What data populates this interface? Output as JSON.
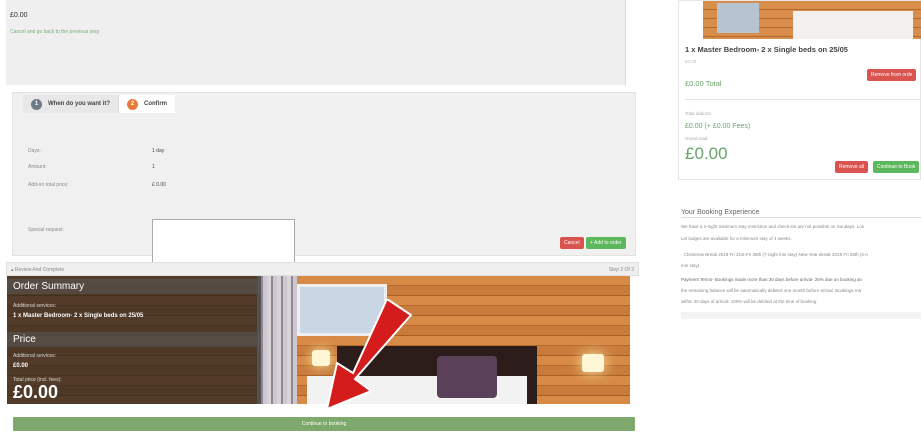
{
  "top": {
    "amount": "£0.00",
    "cancel_link": "Cancel and go back to the previous step"
  },
  "addon": {
    "tabs": [
      {
        "num": "1",
        "label": "When do you want it?"
      },
      {
        "num": "2",
        "label": "Confirm"
      }
    ],
    "fields": {
      "days_label": "Days:",
      "days_value": "1 day",
      "amount_label": "Amount:",
      "amount_value": "1",
      "price_label": "Add-on total price:",
      "price_value": "£ 0.00",
      "request_label": "Special request:",
      "request_value": ""
    },
    "cancel_button": "Cancel",
    "add_button": "+ Add to order"
  },
  "review": {
    "title": "Review And Complete",
    "step": "Step 2 Of 2"
  },
  "summary": {
    "heading": "Order Summary",
    "services_label": "Additional services:",
    "item": "1 x Master Bedroom- 2 x Single beds on 25/05",
    "price_heading": "Price",
    "price_services_label": "Additional services:",
    "price_services_value": "£0.00",
    "total_label": "Total price (incl. fees):",
    "total_value": "£0.00"
  },
  "continue_button": "Continue to booking",
  "cart": {
    "item_title": "1 x Master Bedroom- 2 x Single beds on 25/05",
    "item_small": "£0.00",
    "item_total": "£0.00 Total",
    "remove_button": "Remove from orde",
    "total_addons_label": "Total addons:",
    "fees": "£0.00 (+ £0.00 Fees)",
    "grand_label": "Grand total:",
    "grand_value": "£0.00",
    "remove_all_button": "Remove all",
    "continue_button": "Continue to Book"
  },
  "experience": {
    "title": "Your Booking Experience",
    "lines": [
      "We have a 2-night minimum stay restriction and check-ins are not possible on Sundays. Lon",
      "Let lodges are available for a minimum stay of 4 weeks.",
      "- Christmas Break 2018 Fri 21st-Fri 28th (7-night min stay) New Year Break 2018 Fri 28th (4-n",
      "min stay)",
      "Payment Terms- Bookings made more than 30 days before arrival- 25% due on booking an",
      "the remaining balance will be automatically debited one month before arrival. Bookings ma",
      "within 30 days of arrival- 100% will be debited at the time of booking"
    ]
  },
  "colors": {
    "accent_green": "#5cb85c",
    "danger_red": "#d9534f",
    "price_green": "#6aa36a",
    "continue_bar": "#7fa86d",
    "arrow_red": "#d41c1c"
  }
}
